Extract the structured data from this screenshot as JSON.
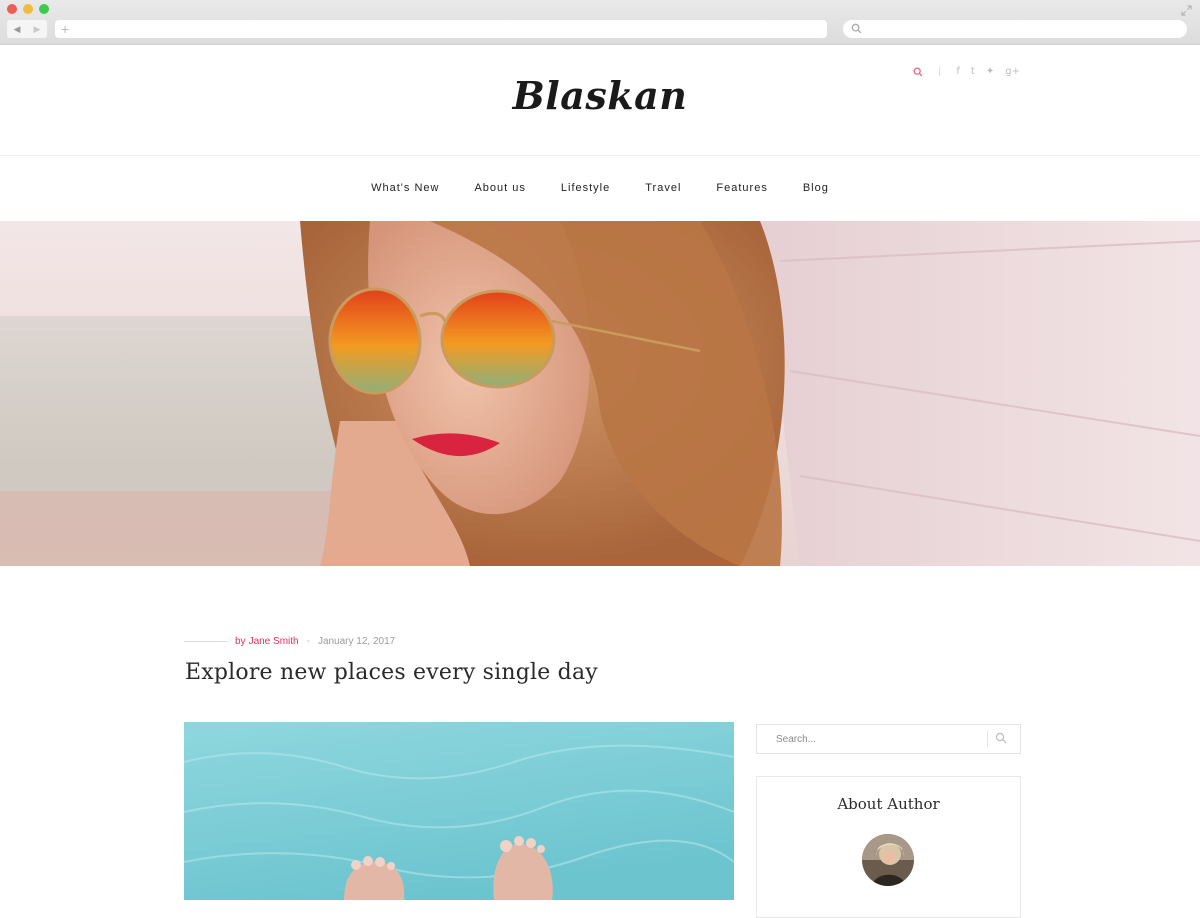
{
  "browser": {
    "traffic_colors": [
      "#ee5d55",
      "#f1bc3b",
      "#3ec94f"
    ],
    "nav_back": "◀",
    "nav_forward": "▶",
    "new_tab": "+",
    "expand_icon": "fullscreen-icon"
  },
  "site": {
    "logo": "Blaskan",
    "accent_color": "#e0335c",
    "header_icons": [
      "search-icon",
      "facebook-icon",
      "tumblr-icon",
      "twitter-icon",
      "google-plus-icon"
    ],
    "header_glyphs": {
      "facebook": "f",
      "tumblr": "t",
      "twitter": "✦",
      "google_plus": "g+",
      "separator": "|"
    }
  },
  "nav": {
    "items": [
      "What's New",
      "About us",
      "Lifestyle",
      "Travel",
      "Features",
      "Blog"
    ]
  },
  "post": {
    "author_prefix": "by",
    "author": "Jane Smith",
    "date": "January 12, 2017",
    "title": "Explore new places every single day"
  },
  "sidebar": {
    "search_placeholder": "Search...",
    "about_title": "About Author"
  }
}
